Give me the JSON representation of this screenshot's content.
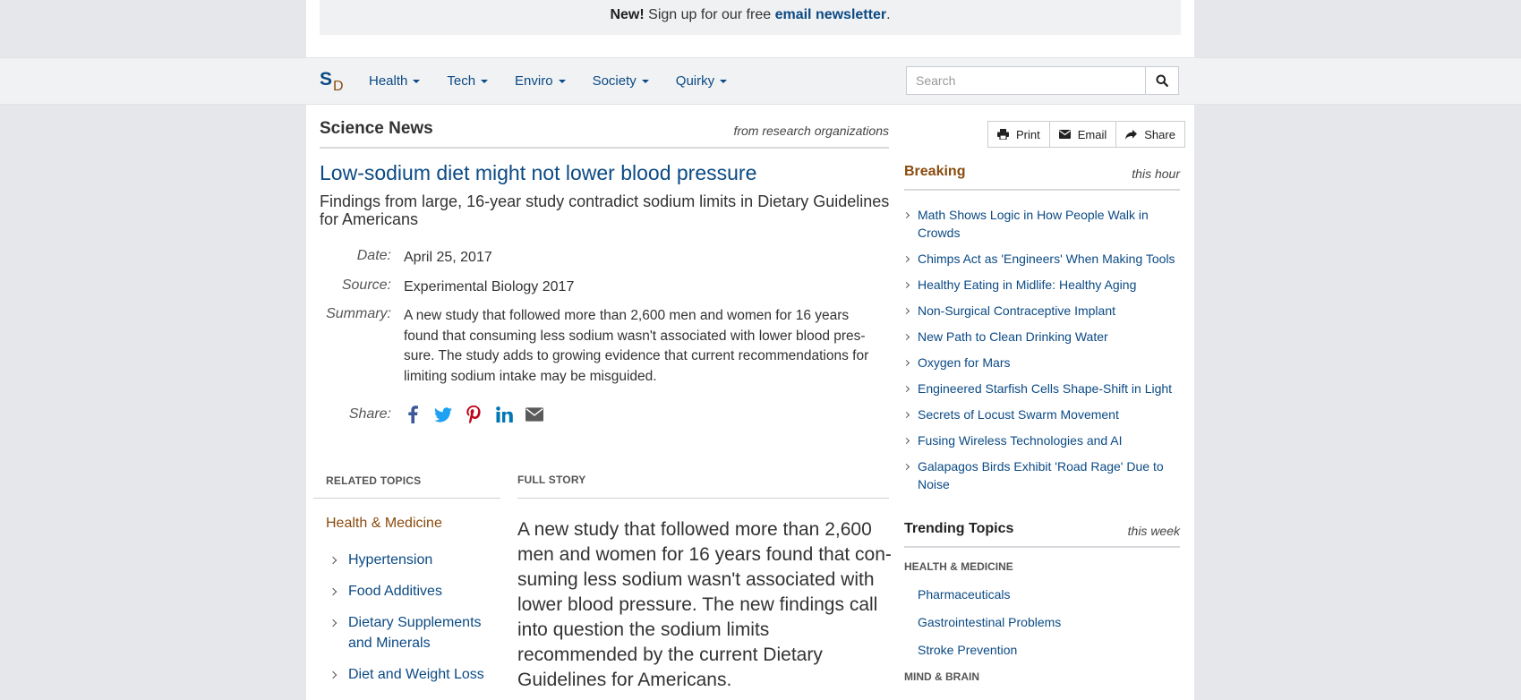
{
  "newsletter": {
    "prefix": "New!",
    "text": "Sign up for our free",
    "link": "email newsletter",
    "suffix": "."
  },
  "nav": {
    "logo_s": "S",
    "logo_d": "D",
    "items": [
      {
        "label": "Health"
      },
      {
        "label": "Tech"
      },
      {
        "label": "Enviro"
      },
      {
        "label": "Society"
      },
      {
        "label": "Quirky"
      }
    ],
    "search_placeholder": "Search"
  },
  "section": {
    "title": "Science News",
    "subtitle": "from research organizations"
  },
  "article": {
    "headline": "Low-sodium diet might not lower blood pressure",
    "subtitle": "Findings from large, 16-year study contradict sodium limits in Dietary Guidelines for Americans",
    "date_label": "Date:",
    "date": "April 25, 2017",
    "source_label": "Source:",
    "source": "Experimental Biology 2017",
    "summary_label": "Summary:",
    "summary": "A new study that followed more than 2,600 men and women for 16 years found that consuming less sodium wasn't associated with lower blood pres-sure. The study adds to growing evidence that current recommendations for limiting sodium intake may be misguided.",
    "share_label": "Share:"
  },
  "related": {
    "heading": "RELATED TOPICS",
    "category": "Health & Medicine",
    "items": [
      "Hypertension",
      "Food Additives",
      "Dietary Supplements and Minerals",
      "Diet and Weight Loss"
    ]
  },
  "story": {
    "heading": "FULL STORY",
    "text": "A new study that followed more than 2,600 men and women for 16 years found that con-suming less sodium wasn't associated with lower blood pressure. The new findings call into question the sodium limits recommended by the current Dietary Guidelines for Americans."
  },
  "tools": {
    "print": "Print",
    "email": "Email",
    "share": "Share"
  },
  "breaking": {
    "title": "Breaking",
    "subtitle": "this hour",
    "items": [
      "Math Shows Logic in How People Walk in Crowds",
      "Chimps Act as 'Engineers' When Making Tools",
      "Healthy Eating in Midlife: Healthy Aging",
      "Non-Surgical Contraceptive Implant",
      "New Path to Clean Drinking Water",
      "Oxygen for Mars",
      "Engineered Starfish Cells Shape-Shift in Light",
      "Secrets of Locust Swarm Movement",
      "Fusing Wireless Technologies and AI",
      "Galapagos Birds Exhibit 'Road Rage' Due to Noise"
    ]
  },
  "trending": {
    "title": "Trending Topics",
    "subtitle": "this week",
    "cat1": "HEALTH & MEDICINE",
    "items": [
      "Pharmaceuticals",
      "Gastrointestinal Problems",
      "Stroke Prevention"
    ],
    "cat2": "MIND & BRAIN"
  },
  "colors": {
    "link": "#0b4a84",
    "accent": "#8a4b0e",
    "background": "#e6e7eb"
  }
}
